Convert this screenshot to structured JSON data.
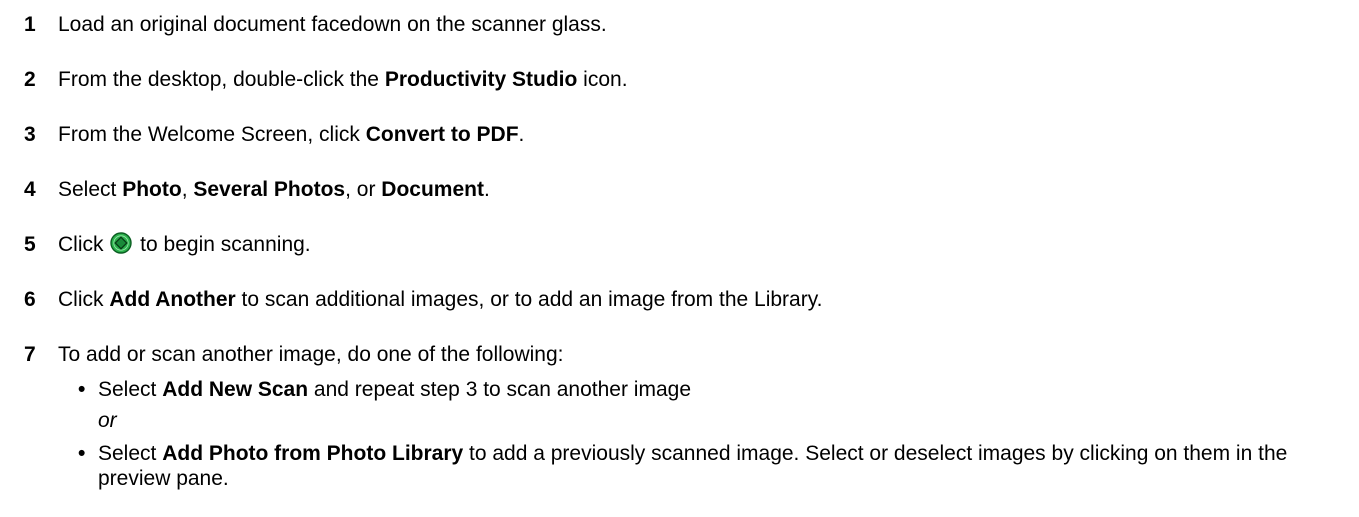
{
  "steps": [
    {
      "num": "1",
      "text": "Load an original document facedown on the scanner glass."
    },
    {
      "num": "2",
      "pre": "From the desktop, double-click the ",
      "bold": "Productivity Studio",
      "post": " icon."
    },
    {
      "num": "3",
      "pre": "From the Welcome Screen, click ",
      "bold": "Convert to PDF",
      "post": "."
    },
    {
      "num": "4",
      "pre": "Select ",
      "bold1": "Photo",
      "sep1": ", ",
      "bold2": "Several Photos",
      "sep2": ", or ",
      "bold3": "Document",
      "post": "."
    },
    {
      "num": "5",
      "pre": "Click ",
      "icon": "scan-start-icon",
      "post": " to begin scanning."
    },
    {
      "num": "6",
      "pre": "Click ",
      "bold": "Add Another",
      "post": " to scan additional images, or to add an image from the Library."
    },
    {
      "num": "7",
      "text": "To add or scan another image, do one of the following:"
    }
  ],
  "options": [
    {
      "bullet": "•",
      "pre": "Select ",
      "bold": "Add New Scan",
      "post": " and repeat step 3 to scan another image"
    },
    {
      "bullet": "•",
      "pre": "Select ",
      "bold": "Add Photo from Photo Library",
      "post": " to add a previously scanned image. Select or deselect images by clicking on them in the preview pane."
    }
  ],
  "or_text": "or",
  "colors": {
    "icon_green": "#2bb24c",
    "icon_dark": "#0b5e22"
  }
}
